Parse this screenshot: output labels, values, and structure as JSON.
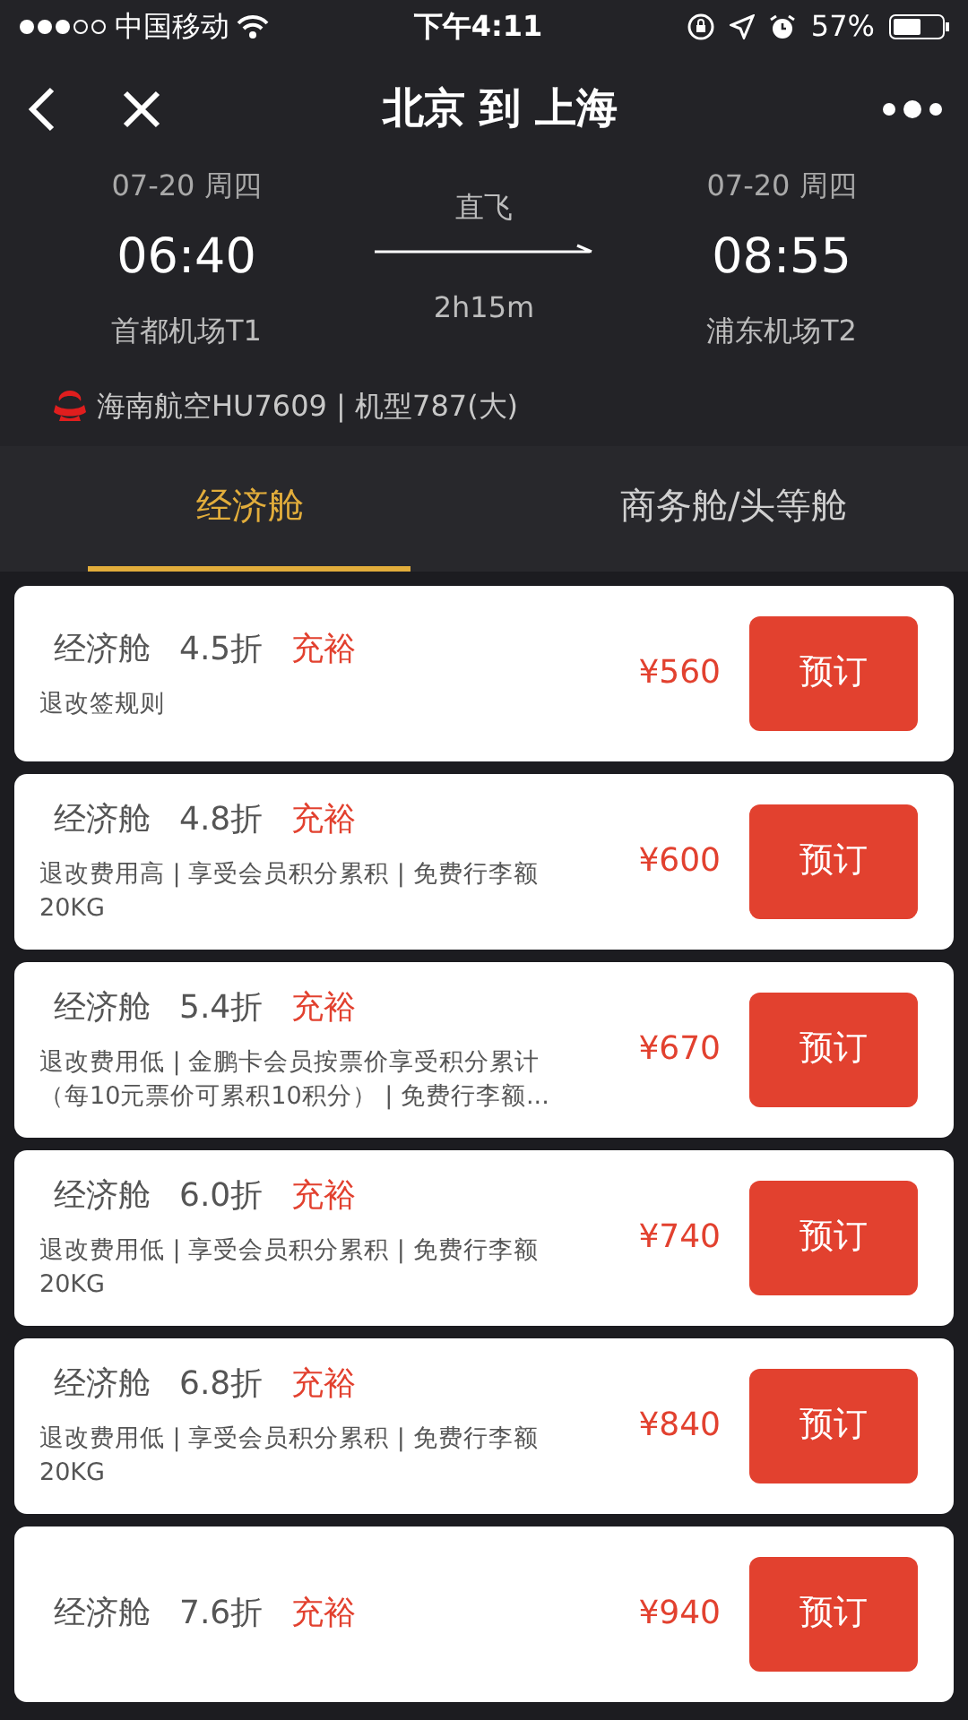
{
  "status_bar": {
    "carrier": "中国移动",
    "time": "下午4:11",
    "battery": "57%"
  },
  "nav": {
    "title": "北京 到 上海"
  },
  "flight": {
    "depart": {
      "date": "07-20 周四",
      "time": "06:40",
      "airport": "首都机场T1"
    },
    "type": "直飞",
    "duration": "2h15m",
    "arrive": {
      "date": "07-20 周四",
      "time": "08:55",
      "airport": "浦东机场T2"
    },
    "airline": "海南航空HU7609 | 机型787(大)"
  },
  "tabs": [
    {
      "label": "经济舱",
      "selected": true
    },
    {
      "label": "商务舱/头等舱",
      "selected": false
    }
  ],
  "fares": [
    {
      "cabin": "经济舱",
      "discount": "4.5折",
      "availability": "充裕",
      "rules": "退改签规则",
      "price": "¥560",
      "button": "预订"
    },
    {
      "cabin": "经济舱",
      "discount": "4.8折",
      "availability": "充裕",
      "rules": "退改费用高 | 享受会员积分累积 | 免费行李额20KG",
      "price": "¥600",
      "button": "预订"
    },
    {
      "cabin": "经济舱",
      "discount": "5.4折",
      "availability": "充裕",
      "rules": "退改费用低 | 金鹏卡会员按票价享受积分累计（每10元票价可累积10积分） | 免费行李额...",
      "price": "¥670",
      "button": "预订"
    },
    {
      "cabin": "经济舱",
      "discount": "6.0折",
      "availability": "充裕",
      "rules": "退改费用低 | 享受会员积分累积 | 免费行李额20KG",
      "price": "¥740",
      "button": "预订"
    },
    {
      "cabin": "经济舱",
      "discount": "6.8折",
      "availability": "充裕",
      "rules": "退改费用低 | 享受会员积分累积 | 免费行李额20KG",
      "price": "¥840",
      "button": "预订"
    },
    {
      "cabin": "经济舱",
      "discount": "7.6折",
      "availability": "充裕",
      "price": "¥940",
      "button": "预订"
    }
  ]
}
